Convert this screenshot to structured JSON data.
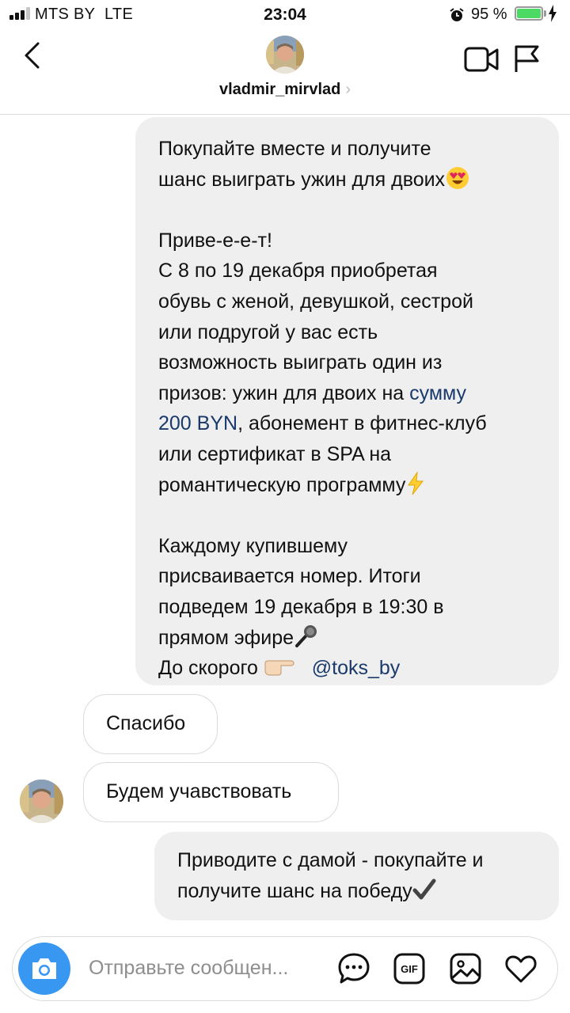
{
  "status_bar": {
    "carrier": "MTS BY",
    "network": "LTE",
    "time": "23:04",
    "battery_percent": "95 %",
    "battery_level": 0.95,
    "signal_bars": 3
  },
  "header": {
    "username": "vladmir_mirvlad",
    "chevron": "›"
  },
  "messages": {
    "m1": {
      "line1": "Покупайте вместе и получите",
      "line2": "шанс выиграть ужин для двоих",
      "greet": "Приве-е-е-т!",
      "p1": "С 8 по 19 декабря приобретая",
      "p2": "обувь с женой, девушкой, сестрой",
      "p3": "или подругой у вас есть",
      "p4": "возможность выиграть один из",
      "p5a": "призов: ужин для двоих на ",
      "p5link": "сумму",
      "p6link": "200 BYN",
      "p6b": ", абонемент в фитнес-клуб",
      "p7": "или сертификат в SPA на",
      "p8": "романтическую программу",
      "q1": "Каждому купившему",
      "q2": "присваивается номер. Итоги",
      "q3": "подведем 19 декабря в 19:30 в",
      "q4": "прямом эфире",
      "q5": "До скорого ",
      "mention": "@toks_by"
    },
    "m2": "Спасибо",
    "m3": "Будем учавствовать",
    "m4": {
      "line1": "Приводите с дамой - покупайте и",
      "line2": "получите шанс на победу"
    }
  },
  "composer": {
    "placeholder": "Отправьте сообщен..."
  },
  "colors": {
    "sent_bubble": "#efefef",
    "link": "#1a3a6b",
    "camera_button": "#3897f0",
    "battery_fill": "#4cd964"
  },
  "icons": [
    "back-chevron-icon",
    "video-call-icon",
    "flag-icon",
    "camera-icon",
    "sticker-chat-icon",
    "gif-icon",
    "gallery-icon",
    "heart-icon",
    "alarm-icon",
    "charging-icon",
    "heart-eyes-emoji",
    "lightning-emoji",
    "microphone-emoji",
    "pointing-hand-emoji",
    "check-mark-emoji"
  ]
}
